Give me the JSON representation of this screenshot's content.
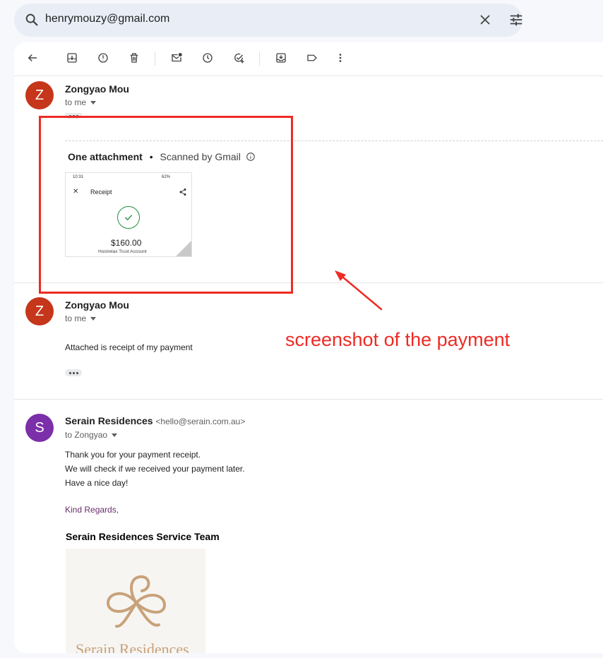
{
  "search": {
    "query": "henrymouzy@gmail.com"
  },
  "toolbar": {
    "icons": [
      "back-icon",
      "archive-icon",
      "report-spam-icon",
      "delete-icon",
      "mark-unread-icon",
      "snooze-icon",
      "add-task-icon",
      "move-to-icon",
      "label-icon",
      "more-icon"
    ]
  },
  "messages": [
    {
      "avatar_letter": "Z",
      "avatar_color": "#c5361b",
      "sender": "Zongyao Mou",
      "to": "to me",
      "attachment": {
        "title": "One attachment",
        "bullet": "•",
        "scanned": "Scanned by Gmail",
        "thumb_time": "10:31",
        "thumb_status": "62%",
        "thumb_title": "Receipt",
        "thumb_amount": "$160.00",
        "thumb_account": "Hostrelax Trust Account"
      }
    },
    {
      "avatar_letter": "Z",
      "avatar_color": "#c5361b",
      "sender": "Zongyao Mou",
      "to": "to me",
      "body": "Attached is receipt of my payment"
    },
    {
      "avatar_letter": "S",
      "avatar_color": "#7b2fa8",
      "sender": "Serain Residences",
      "email": "<hello@serain.com.au>",
      "to": "to Zongyao",
      "body_lines": [
        "Thank you for your payment receipt.",
        "We will check if we received your payment later.",
        "Have a nice day!"
      ],
      "regards": "Kind Regards,",
      "signature": "Serain Residences Service Team",
      "logo_text": "Serain Residences"
    }
  ],
  "annotation": {
    "text": "screenshot of the payment",
    "color": "#ee2b24"
  }
}
